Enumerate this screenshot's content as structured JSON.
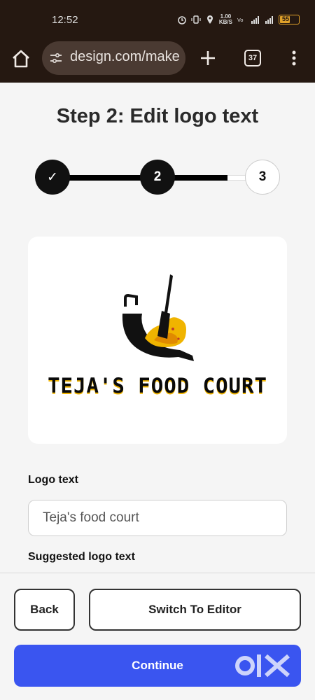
{
  "status_bar": {
    "time": "12:52",
    "speed_value": "1.00",
    "speed_unit": "KB/S",
    "battery_level": "55"
  },
  "browser": {
    "url": "design.com/make",
    "tab_count": "37"
  },
  "page": {
    "title": "Step 2: Edit logo text"
  },
  "stepper": {
    "steps": [
      {
        "label": "✓",
        "state": "done"
      },
      {
        "label": "2",
        "state": "current"
      },
      {
        "label": "3",
        "state": "upcoming"
      }
    ]
  },
  "logo_preview": {
    "text": "Teja's food court"
  },
  "form": {
    "logo_text_label": "Logo text",
    "logo_text_value": "Teja's food court",
    "suggested_label": "Suggested logo text"
  },
  "actions": {
    "back_label": "Back",
    "switch_label": "Switch To Editor",
    "continue_label": "Continue"
  },
  "watermark": {
    "text": "OLX"
  },
  "colors": {
    "status_bg": "#251811",
    "primary_button": "#3a55f0",
    "accent_yellow": "#f0b400"
  }
}
